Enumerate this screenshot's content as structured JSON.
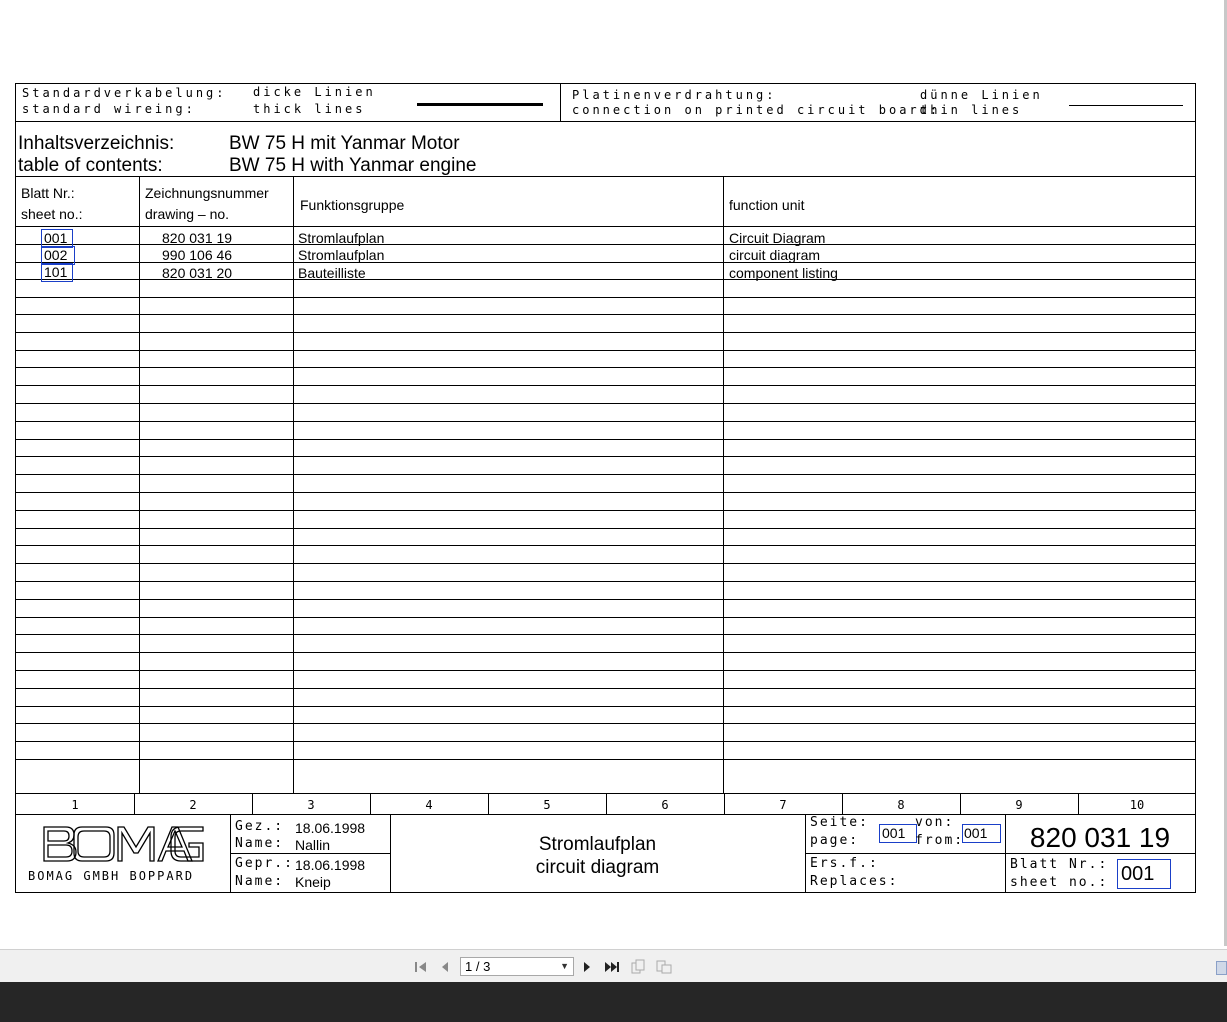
{
  "legend": {
    "std_de": "Standardverkabelung:",
    "std_en": "standard wireing:",
    "thick_de": "dicke Linien",
    "thick_en": "thick lines",
    "pcb_de": "Platinenverdrahtung:",
    "pcb_en": "connection on printed circuit board:",
    "thin_de": "dünne Linien",
    "thin_en": "thin lines"
  },
  "toc": {
    "label_de": "Inhaltsverzeichnis:",
    "label_en": "table of contents:",
    "title_de": "BW 75 H mit Yanmar Motor",
    "title_en": "BW 75 H with Yanmar engine"
  },
  "table": {
    "headers": {
      "sheet_de": "Blatt Nr.:",
      "sheet_en": "sheet no.:",
      "drawing_de": "Zeichnungsnummer",
      "drawing_en": "drawing – no.",
      "group_de": "Funktionsgruppe",
      "unit_en": "function unit"
    },
    "rows": [
      {
        "sheet": "001",
        "drawing": "820 031 19",
        "group": "Stromlaufplan",
        "unit": "Circuit Diagram"
      },
      {
        "sheet": "002",
        "drawing": "990 106 46",
        "group": "Stromlaufplan",
        "unit": "circuit diagram"
      },
      {
        "sheet": "101",
        "drawing": "820 031 20",
        "group": "Bauteilliste",
        "unit": "component listing"
      }
    ]
  },
  "columns": [
    "1",
    "2",
    "3",
    "4",
    "5",
    "6",
    "7",
    "8",
    "9",
    "10"
  ],
  "titleblock": {
    "logo": "BOMAG",
    "company": "BOMAG GMBH BOPPARD",
    "gez_label": "Gez.:",
    "gez_date": "18.06.1998",
    "name_label": "Name:",
    "name1": "Nallin",
    "gepr_label": "Gepr.:",
    "gepr_date": "18.06.1998",
    "name2": "Kneip",
    "title_de": "Stromlaufplan",
    "title_en": "circuit diagram",
    "seite_label": "Seite:",
    "page_label": "page:",
    "page_value": "001",
    "von_label": "von:",
    "from_label": "from:",
    "from_value": "001",
    "drawing_no": "820 031 19",
    "ersf_label": "Ers.f.:",
    "replaces_label": "Replaces:",
    "blatt_label": "Blatt Nr.:",
    "sheet_label": "sheet no.:",
    "sheet_value": "001"
  },
  "viewer": {
    "page_indicator": "1 / 3"
  }
}
